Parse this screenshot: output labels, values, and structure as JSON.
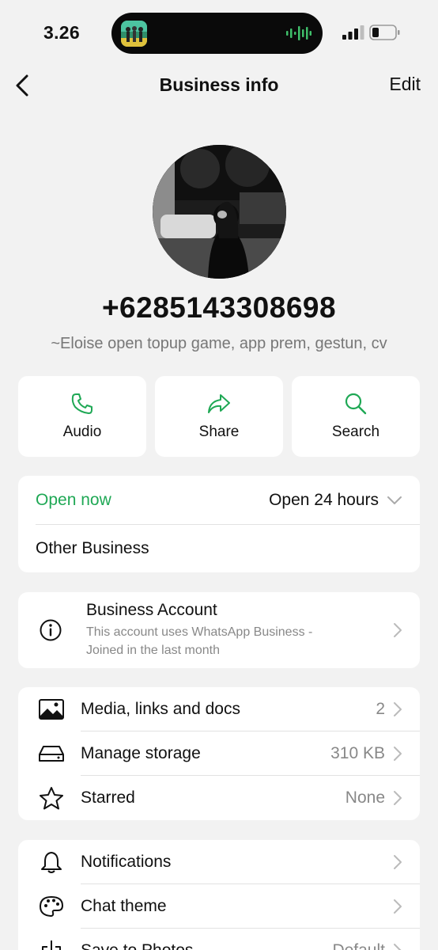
{
  "status": {
    "time": "3.26"
  },
  "nav": {
    "title": "Business info",
    "edit_label": "Edit"
  },
  "profile": {
    "phone": "+6285143308698",
    "about": "~Eloise open topup game, app prem, gestun, cv"
  },
  "actions": [
    {
      "label": "Audio",
      "icon": "phone-icon"
    },
    {
      "label": "Share",
      "icon": "share-arrow-icon"
    },
    {
      "label": "Search",
      "icon": "search-icon"
    }
  ],
  "hours": {
    "status": "Open now",
    "schedule": "Open 24 hours",
    "category": "Other Business"
  },
  "business_account": {
    "title": "Business Account",
    "subtitle": "This account uses WhatsApp Business - Joined in the last month"
  },
  "media_list": [
    {
      "label": "Media, links and docs",
      "value": "2",
      "icon": "image-icon"
    },
    {
      "label": "Manage storage",
      "value": "310 KB",
      "icon": "storage-icon"
    },
    {
      "label": "Starred",
      "value": "None",
      "icon": "star-icon"
    }
  ],
  "settings_list": [
    {
      "label": "Notifications",
      "value": "",
      "icon": "bell-icon"
    },
    {
      "label": "Chat theme",
      "value": "",
      "icon": "palette-icon"
    },
    {
      "label": "Save to Photos",
      "value": "Default",
      "icon": "save-photos-icon"
    }
  ],
  "colors": {
    "accent": "#1fa855",
    "background": "#f2f2f2",
    "card": "#ffffff",
    "secondary_text": "#888888"
  }
}
